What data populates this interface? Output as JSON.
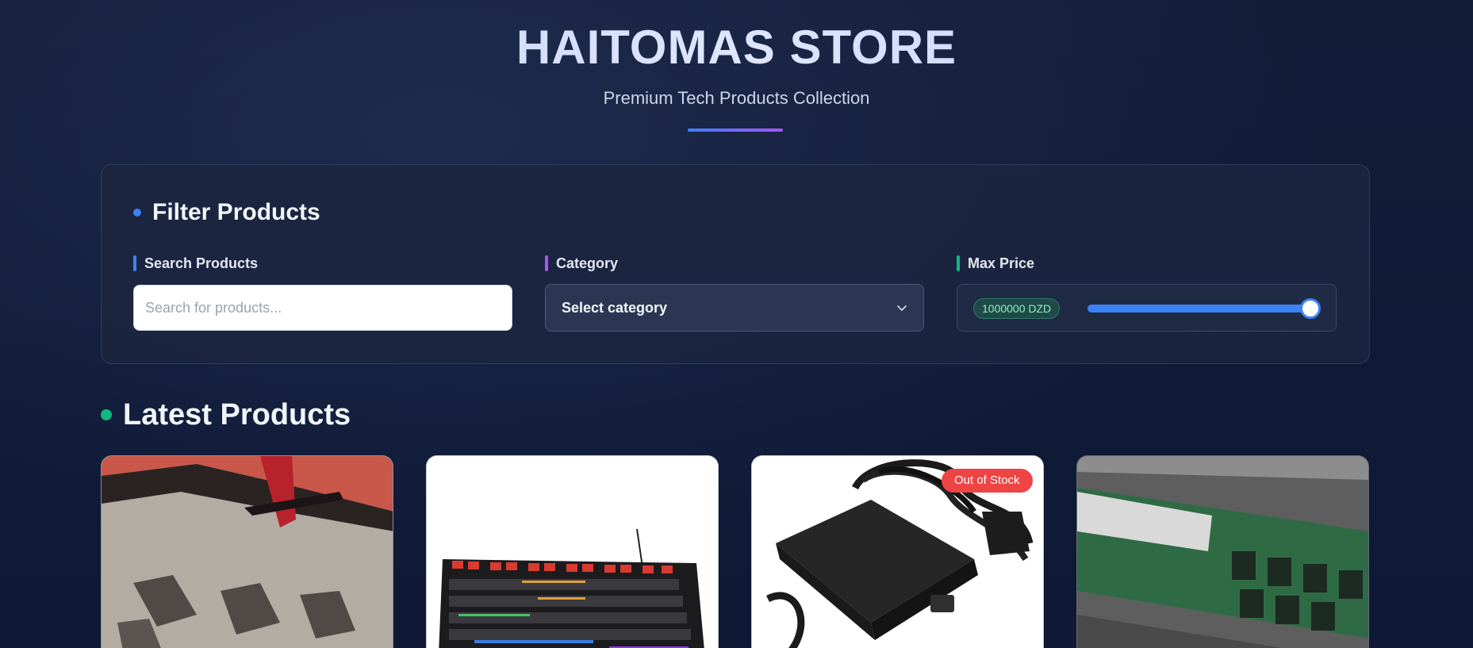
{
  "header": {
    "title": "HAITOMAS STORE",
    "subtitle": "Premium Tech Products Collection"
  },
  "filters": {
    "heading": "Filter Products",
    "search": {
      "label": "Search Products",
      "placeholder": "Search for products...",
      "value": ""
    },
    "category": {
      "label": "Category",
      "selected": "Select category"
    },
    "max_price": {
      "label": "Max Price",
      "value_display": "1000000 DZD",
      "slider_fraction": 1.0
    }
  },
  "latest": {
    "heading": "Latest Products",
    "products": [
      {
        "image": "gaming-chair-on-mousepad",
        "badge": ""
      },
      {
        "image": "rgb-mechanical-keyboard",
        "badge": ""
      },
      {
        "image": "laptop-power-adapter",
        "badge": "Out of Stock"
      },
      {
        "image": "ram-memory-module",
        "badge": ""
      }
    ]
  },
  "colors": {
    "accent_blue": "#3b82f6",
    "accent_purple": "#a855f7",
    "accent_green": "#10b981",
    "out_of_stock": "#ef4444",
    "background": "#101a33"
  },
  "icons": {
    "category_chevron": "chevron-down-icon"
  }
}
